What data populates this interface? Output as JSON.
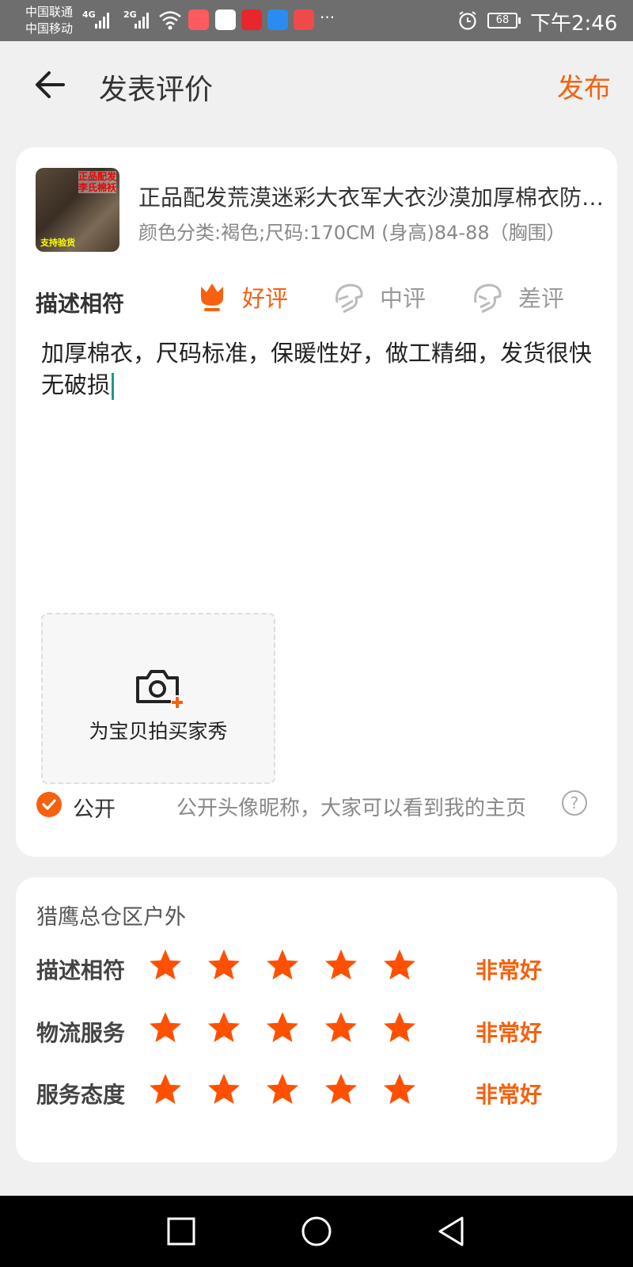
{
  "status_bar": {
    "carrier1": "中国联通",
    "carrier2": "中国移动",
    "net1": "4G",
    "net2": "2G",
    "battery": "68",
    "time": "下午2:46",
    "more": "···"
  },
  "header": {
    "title": "发表评价",
    "publish_label": "发布"
  },
  "product": {
    "thumb_tag": "正品配发\n李氏棉袄",
    "thumb_foot": "支持验货",
    "name": "正品配发荒漠迷彩大衣军大衣沙漠加厚棉衣防寒服冬季男",
    "sku": "颜色分类:褐色;尺码:170CM (身高)84-88（胸围）"
  },
  "description": {
    "label": "描述相符",
    "options": [
      {
        "label": "好评",
        "selected": true
      },
      {
        "label": "中评",
        "selected": false
      },
      {
        "label": "差评",
        "selected": false
      }
    ],
    "review_text": "加厚棉衣，尺码标准，保暖性好，做工精细，发货很快无破损"
  },
  "photo": {
    "label": "为宝贝拍买家秀"
  },
  "public": {
    "label": "公开",
    "checked": true,
    "hint": "公开头像昵称，大家可以看到我的主页",
    "help": "?"
  },
  "shop": {
    "name": "猎鹰总仓区户外",
    "ratings": [
      {
        "label": "描述相符",
        "stars": 5,
        "max": 5,
        "value": "非常好"
      },
      {
        "label": "物流服务",
        "stars": 5,
        "max": 5,
        "value": "非常好"
      },
      {
        "label": "服务态度",
        "stars": 5,
        "max": 5,
        "value": "非常好"
      }
    ]
  },
  "colors": {
    "accent": "#f5610f",
    "star": "#ff5000"
  }
}
